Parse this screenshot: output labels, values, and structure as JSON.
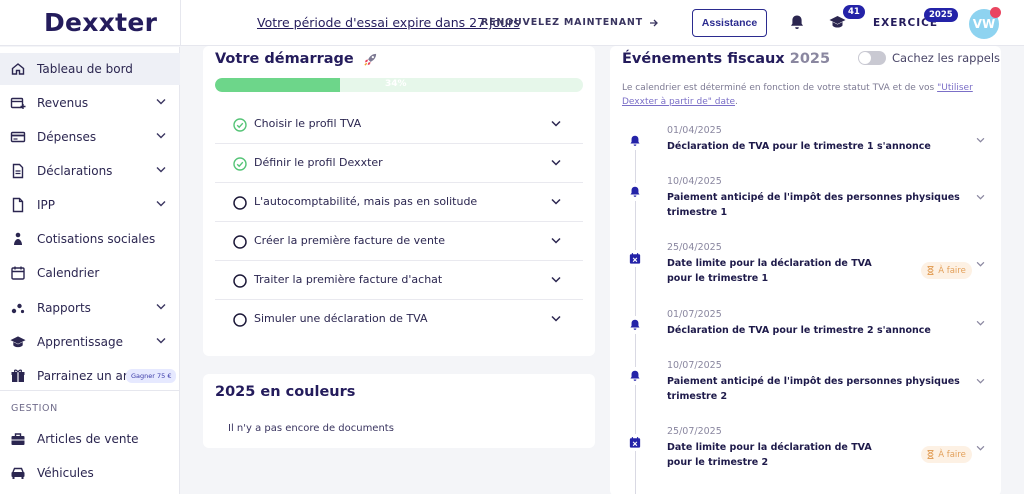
{
  "brand": {
    "logo": "Dexxter"
  },
  "header": {
    "trial_text": "Votre période d'essai expire dans 27 jours",
    "renew_label": "RENOUVELEZ MAINTENANT",
    "assistance_label": "Assistance",
    "notifications_icon": "bell-icon",
    "learning_icon": "graduation-cap-icon",
    "learning_badge": "41",
    "exercise_label": "EXERCICE",
    "exercise_badge": "2025",
    "avatar_initials": "VW"
  },
  "sidebar": {
    "items": [
      {
        "label": "Tableau de bord",
        "icon": "home-icon",
        "active": true,
        "expandable": false
      },
      {
        "label": "Revenus",
        "icon": "revenue-icon",
        "expandable": true
      },
      {
        "label": "Dépenses",
        "icon": "card-icon",
        "expandable": true
      },
      {
        "label": "Déclarations",
        "icon": "document-icon",
        "expandable": true
      },
      {
        "label": "IPP",
        "icon": "file-icon",
        "expandable": true
      },
      {
        "label": "Cotisations sociales",
        "icon": "person-icon",
        "expandable": false
      },
      {
        "label": "Calendrier",
        "icon": "calendar-icon",
        "expandable": false
      },
      {
        "label": "Rapports",
        "icon": "chart-icon",
        "expandable": true
      },
      {
        "label": "Apprentissage",
        "icon": "graduation-cap-icon",
        "expandable": true
      },
      {
        "label": "Parrainez un ami",
        "icon": "gift-icon",
        "expandable": false,
        "tag": "Gagner 75 €"
      }
    ],
    "section_label": "GESTION",
    "gestion_items": [
      {
        "label": "Articles de vente",
        "icon": "briefcase-icon"
      },
      {
        "label": "Véhicules",
        "icon": "car-icon"
      }
    ]
  },
  "start_card": {
    "title": "Votre démarrage",
    "title_icon": "rocket",
    "progress_percent": 34,
    "progress_label": "34%",
    "steps": [
      {
        "label": "Choisir le profil TVA",
        "done": true
      },
      {
        "label": "Définir le profil Dexxter",
        "done": true
      },
      {
        "label": "L'autocomptabilité, mais pas en solitude",
        "done": false
      },
      {
        "label": "Créer la première facture de vente",
        "done": false
      },
      {
        "label": "Traiter la première facture d'achat",
        "done": false
      },
      {
        "label": "Simuler une déclaration de TVA",
        "done": false
      }
    ]
  },
  "colors_card": {
    "title": "2025 en couleurs",
    "empty_text": "Il n'y a pas encore de documents"
  },
  "fiscal": {
    "title": "Événements fiscaux",
    "year": "2025",
    "toggle_label": "Cachez les rappels",
    "toggle_on": false,
    "note_before": "Le calendrier est déterminé en fonction de votre statut TVA et de vos ",
    "note_link": "\"Utiliser Dexxter à partir de\" date",
    "note_after": ".",
    "todo_label": "À faire",
    "events": [
      {
        "date": "01/04/2025",
        "title": "Déclaration de TVA pour le trimestre 1 s'annonce",
        "icon": "bell-icon",
        "todo": false
      },
      {
        "date": "10/04/2025",
        "title": "Paiement anticipé de l'impôt des personnes physiques trimestre 1",
        "icon": "bell-icon",
        "todo": false
      },
      {
        "date": "25/04/2025",
        "title": "Date limite pour la déclaration de TVA pour le trimestre 1",
        "icon": "calendar-x-icon",
        "todo": true
      },
      {
        "date": "01/07/2025",
        "title": "Déclaration de TVA pour le trimestre 2 s'annonce",
        "icon": "bell-icon",
        "todo": false
      },
      {
        "date": "10/07/2025",
        "title": "Paiement anticipé de l'impôt des personnes physiques trimestre 2",
        "icon": "bell-icon",
        "todo": false
      },
      {
        "date": "25/07/2025",
        "title": "Date limite pour la déclaration de TVA pour le trimestre 2",
        "icon": "calendar-x-icon",
        "todo": true
      }
    ]
  },
  "colors": {
    "brand": "#241c5c",
    "primary": "#2423a8",
    "progress": "#6dd68a",
    "todo": "#e3a15c",
    "alert": "#e94560"
  }
}
